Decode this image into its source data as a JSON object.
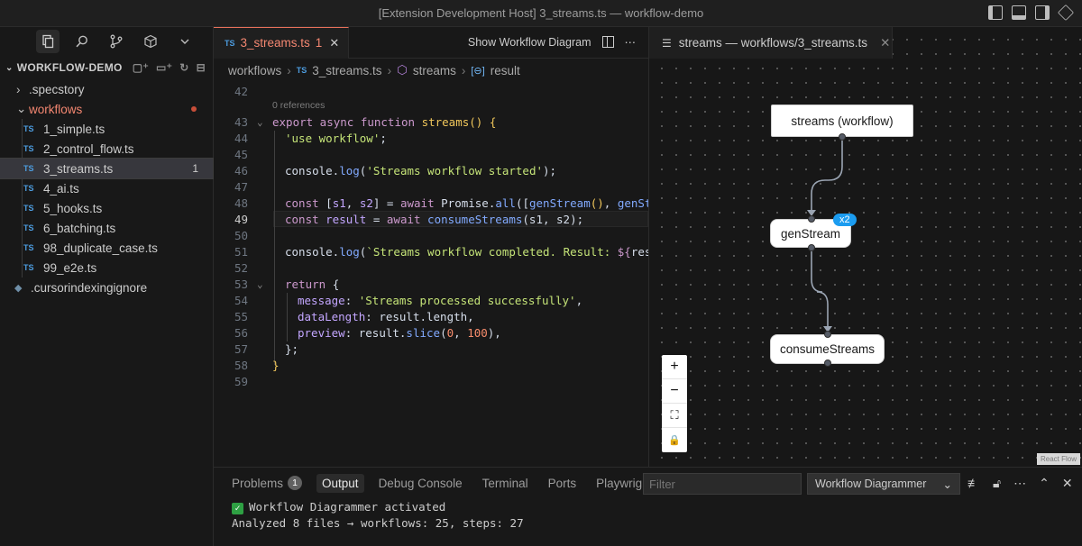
{
  "window": {
    "title": "[Extension Development Host] 3_streams.ts — workflow-demo"
  },
  "explorer": {
    "root": "WORKFLOW-DEMO",
    "items": [
      {
        "label": ".specstory",
        "kind": "folder"
      },
      {
        "label": "workflows",
        "kind": "folder-open"
      },
      {
        "label": "1_simple.ts",
        "kind": "ts"
      },
      {
        "label": "2_control_flow.ts",
        "kind": "ts"
      },
      {
        "label": "3_streams.ts",
        "kind": "ts",
        "badge": "1"
      },
      {
        "label": "4_ai.ts",
        "kind": "ts"
      },
      {
        "label": "5_hooks.ts",
        "kind": "ts"
      },
      {
        "label": "6_batching.ts",
        "kind": "ts"
      },
      {
        "label": "98_duplicate_case.ts",
        "kind": "ts"
      },
      {
        "label": "99_e2e.ts",
        "kind": "ts"
      },
      {
        "label": ".cursorindexingignore",
        "kind": "file"
      }
    ]
  },
  "editor": {
    "tab": {
      "lang": "TS",
      "name": "3_streams.ts",
      "problems": "1"
    },
    "show_diagram_label": "Show Workflow Diagram",
    "breadcrumb": [
      "workflows",
      "3_streams.ts",
      "streams",
      "result"
    ],
    "references": "0 references",
    "line_numbers": [
      "42",
      "43",
      "44",
      "45",
      "46",
      "47",
      "48",
      "49",
      "50",
      "51",
      "52",
      "53",
      "54",
      "55",
      "56",
      "57",
      "58",
      "59"
    ],
    "current_line": "49"
  },
  "diagram": {
    "tab_label": "streams — workflows/3_streams.ts",
    "nodes": {
      "workflow": "streams (workflow)",
      "gen": "genStream",
      "gen_badge": "x2",
      "consume": "consumeStreams"
    },
    "controls": {
      "zoom_in": "+",
      "zoom_out": "−",
      "fit": "⛶",
      "lock": "🔒"
    },
    "attribution": "React Flow"
  },
  "panel": {
    "tabs": [
      "Problems",
      "Output",
      "Debug Console",
      "Terminal",
      "Ports",
      "Playwright"
    ],
    "problems_count": "1",
    "filter_placeholder": "Filter",
    "channel": "Workflow Diagrammer",
    "output": [
      "Workflow Diagrammer activated",
      "Analyzed 8 files → workflows: 25, steps: 27"
    ]
  },
  "colors": {
    "accent": "#e8705a",
    "badge_blue": "#1b9cf0",
    "ts_blue": "#4d9de0"
  }
}
